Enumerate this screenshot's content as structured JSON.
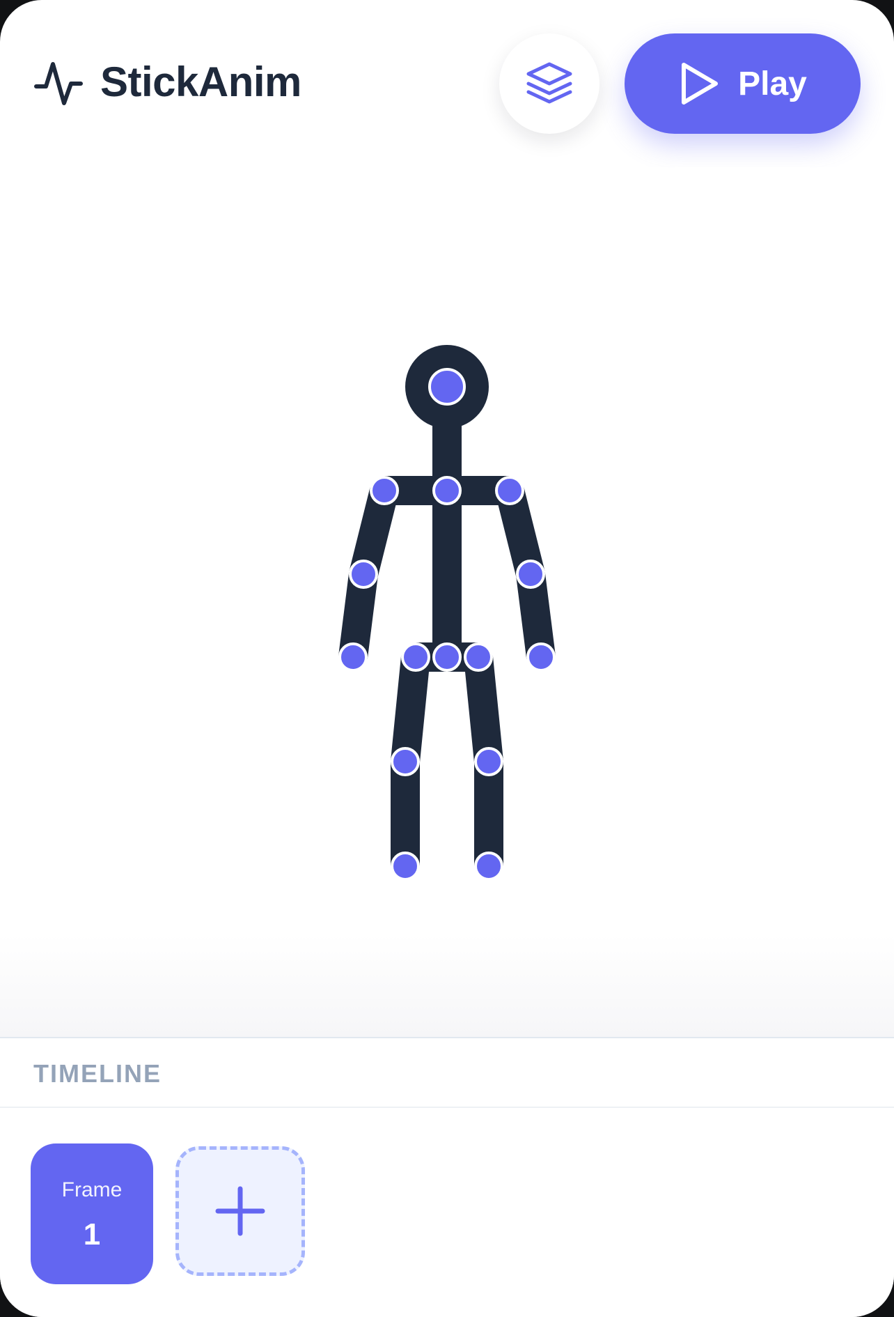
{
  "app": {
    "title": "StickAnim",
    "logo_icon": "activity-pulse-icon"
  },
  "toolbar": {
    "layers_icon": "layers-icon",
    "play_icon": "play-icon",
    "play_label": "Play"
  },
  "colors": {
    "accent": "#6366f1",
    "limb": "#1e293b",
    "joint_outline": "#ffffff",
    "muted_text": "#94a3b8",
    "add_frame_bg": "#eef2ff",
    "add_frame_border": "#a5b4fc"
  },
  "timeline": {
    "label": "TIMELINE",
    "frames": [
      {
        "label": "Frame",
        "number": "1",
        "selected": true
      }
    ],
    "add_frame_icon": "plus-icon"
  }
}
